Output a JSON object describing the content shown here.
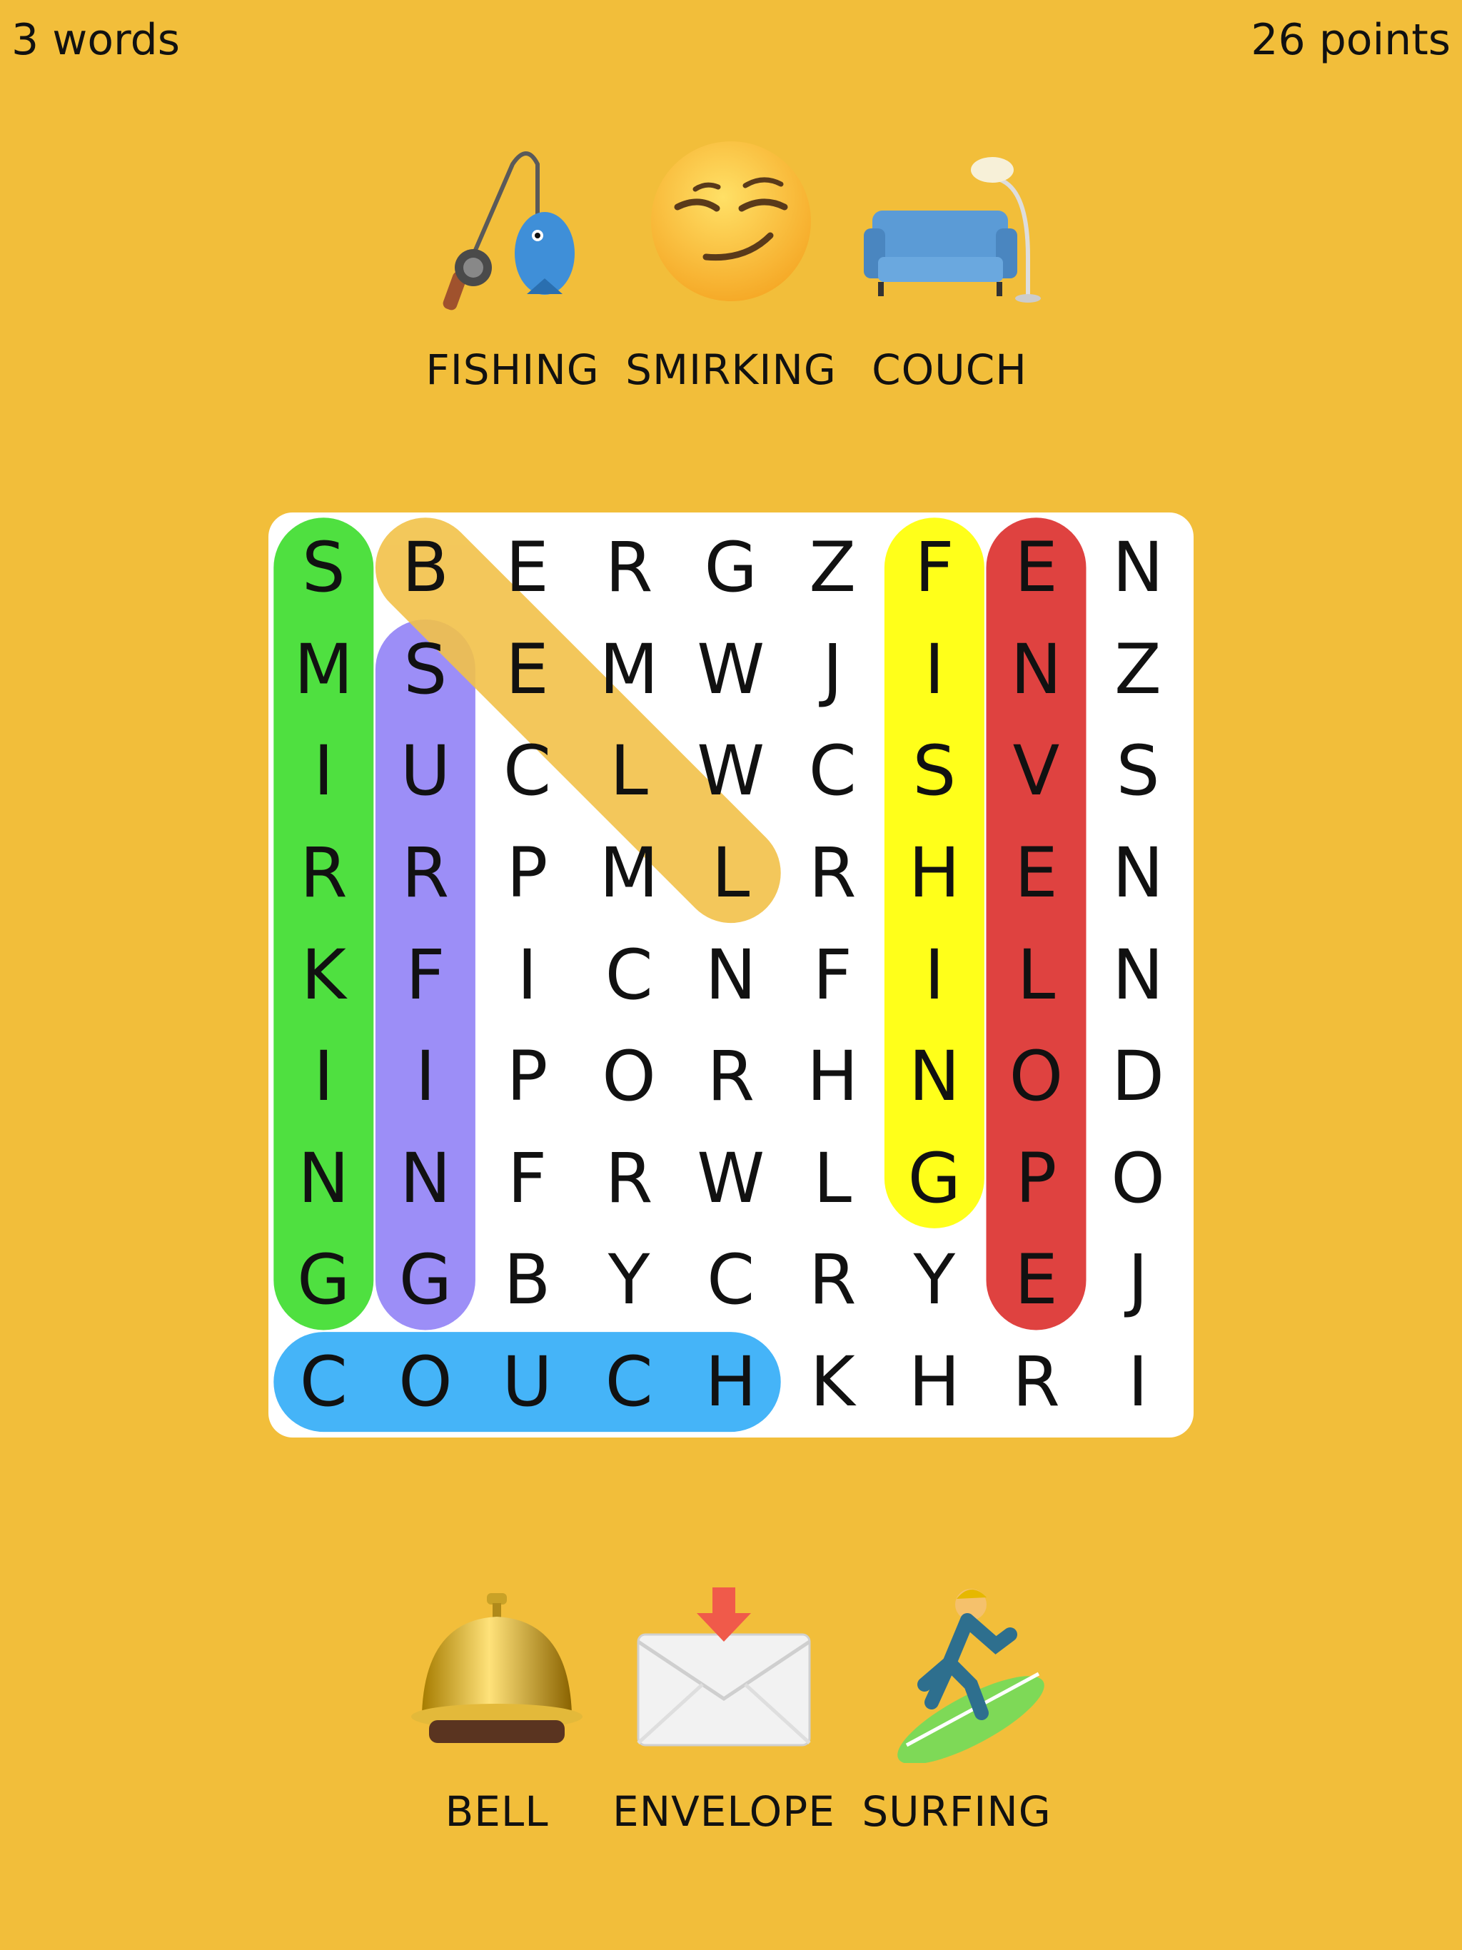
{
  "status": {
    "words_found": "3 words",
    "points": "26 points"
  },
  "found_words": [
    {
      "label": "FISHING",
      "icon": "fishing-pole-icon"
    },
    {
      "label": "SMIRKING",
      "icon": "smirking-face-icon"
    },
    {
      "label": "COUCH",
      "icon": "couch-lamp-icon"
    }
  ],
  "remaining_words": [
    {
      "label": "BELL",
      "icon": "bellhop-bell-icon"
    },
    {
      "label": "ENVELOPE",
      "icon": "envelope-arrow-icon"
    },
    {
      "label": "SURFING",
      "icon": "surfer-icon"
    }
  ],
  "grid": [
    [
      "S",
      "B",
      "E",
      "R",
      "G",
      "Z",
      "F",
      "E",
      "N"
    ],
    [
      "M",
      "S",
      "E",
      "M",
      "W",
      "J",
      "I",
      "N",
      "Z"
    ],
    [
      "I",
      "U",
      "C",
      "L",
      "W",
      "C",
      "S",
      "V",
      "S"
    ],
    [
      "R",
      "R",
      "P",
      "M",
      "L",
      "R",
      "H",
      "E",
      "N"
    ],
    [
      "K",
      "F",
      "I",
      "C",
      "N",
      "F",
      "I",
      "L",
      "N"
    ],
    [
      "I",
      "I",
      "P",
      "O",
      "R",
      "H",
      "N",
      "O",
      "D"
    ],
    [
      "N",
      "N",
      "F",
      "R",
      "W",
      "L",
      "G",
      "P",
      "O"
    ],
    [
      "G",
      "G",
      "B",
      "Y",
      "C",
      "R",
      "Y",
      "E",
      "J"
    ],
    [
      "C",
      "O",
      "U",
      "C",
      "H",
      "K",
      "H",
      "R",
      "I"
    ]
  ],
  "highlights": [
    {
      "word": "SMIRKING",
      "color": "#4FE040",
      "from": [
        0,
        0
      ],
      "to": [
        7,
        0
      ]
    },
    {
      "word": "SURFING",
      "color": "#9C8EF7",
      "from": [
        1,
        1
      ],
      "to": [
        7,
        1
      ]
    },
    {
      "word": "BELL",
      "color": "#F2C24A",
      "from": [
        0,
        1
      ],
      "to": [
        3,
        4
      ]
    },
    {
      "word": "FISHING",
      "color": "#FFFF1A",
      "from": [
        0,
        6
      ],
      "to": [
        6,
        6
      ]
    },
    {
      "word": "ENVELOPE",
      "color": "#DF4240",
      "from": [
        0,
        7
      ],
      "to": [
        7,
        7
      ]
    },
    {
      "word": "COUCH",
      "color": "#45B4F8",
      "from": [
        8,
        0
      ],
      "to": [
        8,
        4
      ]
    }
  ]
}
